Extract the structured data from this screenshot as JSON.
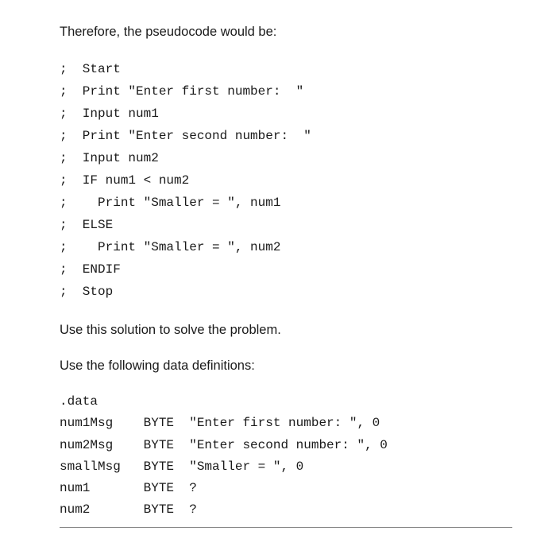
{
  "intro": "Therefore, the pseudocode would be:",
  "pseudocode": {
    "lines": [
      ";  Start",
      ";  Print \"Enter first number:  \"",
      ";  Input num1",
      ";  Print \"Enter second number:  \"",
      ";  Input num2",
      ";  IF num1 < num2",
      ";    Print \"Smaller = \", num1",
      ";  ELSE",
      ";    Print \"Smaller = \", num2",
      ";  ENDIF",
      ";  Stop"
    ]
  },
  "mid1": "Use this solution to solve the problem.",
  "mid2": "Use the following data definitions:",
  "datadefs": {
    "lines": [
      ".data",
      "num1Msg    BYTE  \"Enter first number: \", 0",
      "num2Msg    BYTE  \"Enter second number: \", 0",
      "smallMsg   BYTE  \"Smaller = \", 0",
      "num1       BYTE  ?",
      "num2       BYTE  ?"
    ]
  }
}
